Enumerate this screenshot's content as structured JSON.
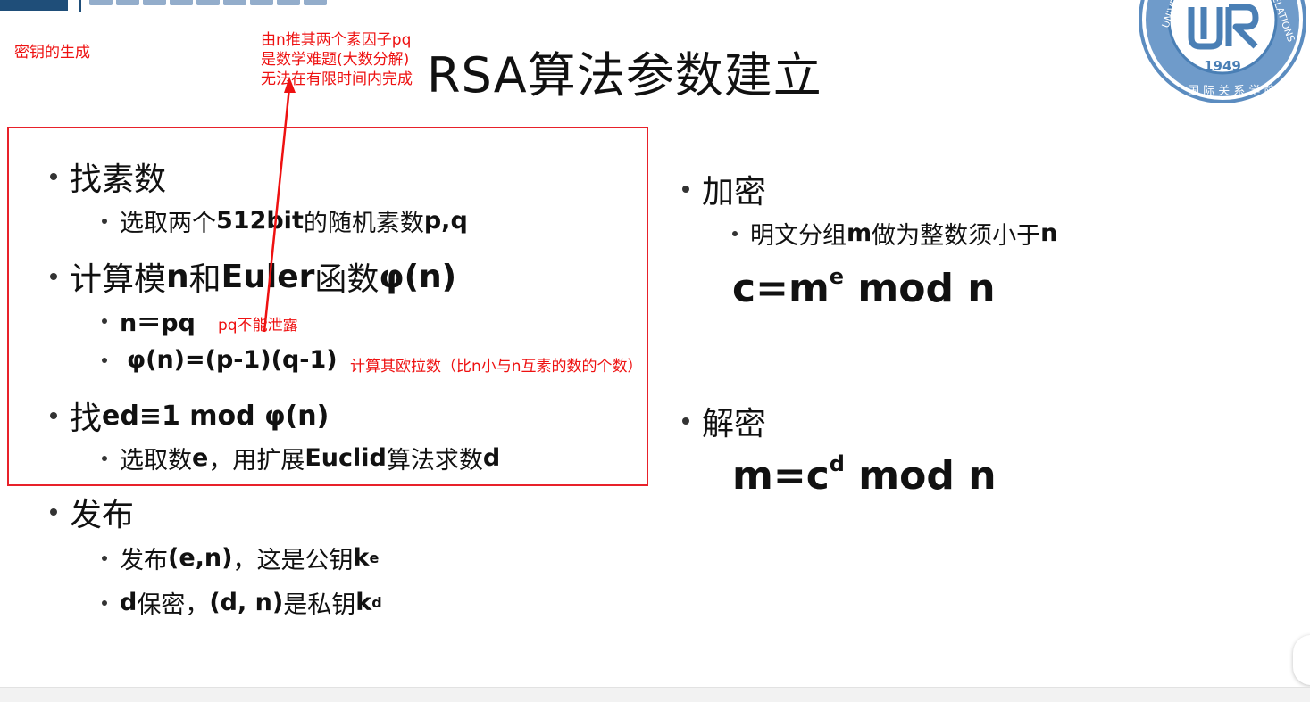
{
  "slide": {
    "title": "RSA算法参数建立",
    "left": {
      "find_prime": {
        "heading": "找素数",
        "sub": {
          "pre": "选取两个",
          "bold": "512bit",
          "mid": "的随机素数",
          "bold2": "p,q"
        }
      },
      "compute": {
        "heading_pre": "计算模",
        "heading_n": "n",
        "heading_mid": "和",
        "heading_euler": "Euler",
        "heading_post": "函数",
        "heading_phi": "φ(n)",
        "sub1": "n＝pq",
        "sub2": "φ(n)=(p-1)(q-1)"
      },
      "find_ed": {
        "heading_pre": "找",
        "heading_bold": "ed≡1 mod φ(n)",
        "sub_pre": "选取数",
        "sub_e": "e",
        "sub_mid": "，用扩展",
        "sub_euclid": "Euclid",
        "sub_post": "算法求数",
        "sub_d": "d"
      },
      "publish": {
        "heading": "发布",
        "sub1_pre": "发布",
        "sub1_bold": "(e,n)",
        "sub1_post": "，这是公钥",
        "sub1_k": "k",
        "sub1_sub": "e",
        "sub2_d": "d",
        "sub2_mid": "保密，",
        "sub2_bold": "(d, n)",
        "sub2_post": "是私钥 ",
        "sub2_k": "k",
        "sub2_sub": "d"
      }
    },
    "right": {
      "encrypt": {
        "heading": "加密",
        "sub_pre": "明文分组",
        "sub_m": "m",
        "sub_mid": "做为整数须小于",
        "sub_n": "n",
        "formula_base": "c=m",
        "formula_exp": "e",
        "formula_tail": " mod n"
      },
      "decrypt": {
        "heading": "解密",
        "formula_base": "m=c",
        "formula_exp": "d",
        "formula_tail": " mod n"
      }
    },
    "annotations": {
      "key_gen": "密钥的生成",
      "factor_line1": "由n推其两个素因子pq",
      "factor_line2": "是数学难题(大数分解)",
      "factor_line3": "无法在有限时间内完成",
      "pq_secret": "pq不能泄露",
      "euler_note": "计算其欧拉数（比n小与n互素的数的个数）"
    },
    "logo": {
      "year": "1949"
    }
  },
  "colors": {
    "annotation": "#ee1111",
    "logo": "#4a7fb5",
    "header": "#1f4e79"
  }
}
